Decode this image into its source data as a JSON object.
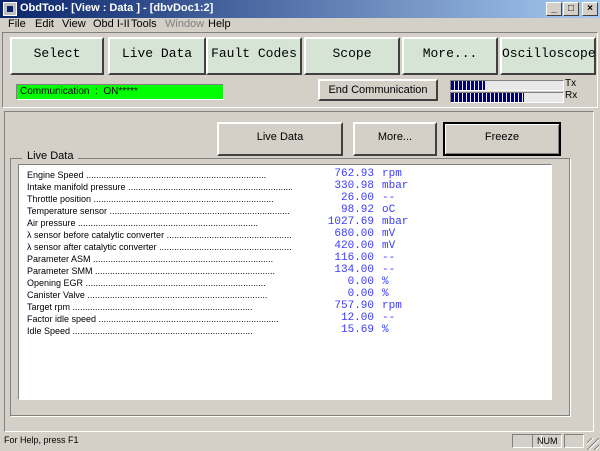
{
  "window": {
    "title": "ObdTool- [View : Data ] - [dbvDoc1:2]",
    "minimize_glyph": "_",
    "maximize_glyph": "□",
    "close_glyph": "×"
  },
  "menu": [
    {
      "label": "File",
      "enabled": true
    },
    {
      "label": "Edit",
      "enabled": true
    },
    {
      "label": "View",
      "enabled": true
    },
    {
      "label": "Obd I-II",
      "enabled": true
    },
    {
      "label": "Tools",
      "enabled": true
    },
    {
      "label": "Window",
      "enabled": false
    },
    {
      "label": "Help",
      "enabled": true
    }
  ],
  "toolbar": {
    "buttons": [
      "Select",
      "Live Data",
      "Fault Codes",
      "Scope",
      "More...",
      "Oscilloscope"
    ]
  },
  "communication": {
    "status": "Communication  :  ON*****",
    "end_label": "End Communication",
    "tx_label": "Tx",
    "rx_label": "Rx",
    "tx_level": 0.3,
    "rx_level": 0.65
  },
  "panel": {
    "buttons": [
      "Live Data",
      "More...",
      "Freeze"
    ],
    "group_title": "Live Data",
    "rows": [
      {
        "label": "Engine Speed",
        "value": "762.93",
        "unit": "rpm"
      },
      {
        "label": "Intake manifold pressure",
        "value": "330.98",
        "unit": "mbar"
      },
      {
        "label": "Throttle position",
        "value": "26.00",
        "unit": "--"
      },
      {
        "label": "Temperature sensor",
        "value": "98.92",
        "unit": "oC"
      },
      {
        "label": "Air pressure",
        "value": "1027.69",
        "unit": "mbar"
      },
      {
        "label": "λ sensor before catalytic converter",
        "value": "680.00",
        "unit": "mV"
      },
      {
        "label": "λ sensor after catalytic converter",
        "value": "420.00",
        "unit": "mV"
      },
      {
        "label": "Parameter ASM",
        "value": "116.00",
        "unit": "--"
      },
      {
        "label": "Parameter SMM",
        "value": "134.00",
        "unit": "--"
      },
      {
        "label": "Opening EGR",
        "value": "0.00",
        "unit": "%"
      },
      {
        "label": "Canister Valve",
        "value": "0.00",
        "unit": "%"
      },
      {
        "label": "Target rpm",
        "value": "757.90",
        "unit": "rpm"
      },
      {
        "label": "Factor idle speed",
        "value": "12.00",
        "unit": "--"
      },
      {
        "label": "Idle Speed",
        "value": "15.69",
        "unit": "%"
      }
    ]
  },
  "status": {
    "help": "For Help, press F1",
    "num": "NUM"
  }
}
